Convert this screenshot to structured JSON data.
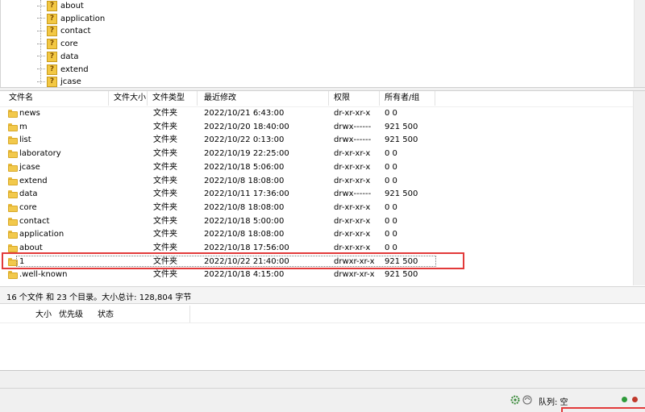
{
  "tree": {
    "items": [
      "about",
      "application",
      "contact",
      "core",
      "data",
      "extend",
      "jcase"
    ]
  },
  "filelist": {
    "headers": {
      "name": "文件名",
      "size": "文件大小",
      "type": "文件类型",
      "modified": "最近修改",
      "perms": "权限",
      "owner": "所有者/组"
    },
    "rows": [
      {
        "name": "news",
        "type": "文件夹",
        "modified": "2022/10/21 6:43:00",
        "perms": "dr-xr-xr-x",
        "owner": "0 0"
      },
      {
        "name": "m",
        "type": "文件夹",
        "modified": "2022/10/20 18:40:00",
        "perms": "drwx------",
        "owner": "921 500"
      },
      {
        "name": "list",
        "type": "文件夹",
        "modified": "2022/10/22 0:13:00",
        "perms": "drwx------",
        "owner": "921 500"
      },
      {
        "name": "laboratory",
        "type": "文件夹",
        "modified": "2022/10/19 22:25:00",
        "perms": "dr-xr-xr-x",
        "owner": "0 0"
      },
      {
        "name": "jcase",
        "type": "文件夹",
        "modified": "2022/10/18 5:06:00",
        "perms": "dr-xr-xr-x",
        "owner": "0 0"
      },
      {
        "name": "extend",
        "type": "文件夹",
        "modified": "2022/10/8 18:08:00",
        "perms": "dr-xr-xr-x",
        "owner": "0 0"
      },
      {
        "name": "data",
        "type": "文件夹",
        "modified": "2022/10/11 17:36:00",
        "perms": "drwx------",
        "owner": "921 500"
      },
      {
        "name": "core",
        "type": "文件夹",
        "modified": "2022/10/8 18:08:00",
        "perms": "dr-xr-xr-x",
        "owner": "0 0"
      },
      {
        "name": "contact",
        "type": "文件夹",
        "modified": "2022/10/18 5:00:00",
        "perms": "dr-xr-xr-x",
        "owner": "0 0"
      },
      {
        "name": "application",
        "type": "文件夹",
        "modified": "2022/10/8 18:08:00",
        "perms": "dr-xr-xr-x",
        "owner": "0 0"
      },
      {
        "name": "about",
        "type": "文件夹",
        "modified": "2022/10/18 17:56:00",
        "perms": "dr-xr-xr-x",
        "owner": "0 0"
      },
      {
        "name": "1",
        "type": "文件夹",
        "modified": "2022/10/22 21:40:00",
        "perms": "drwxr-xr-x",
        "owner": "921 500"
      },
      {
        "name": ".well-known",
        "type": "文件夹",
        "modified": "2022/10/18 4:15:00",
        "perms": "drwxr-xr-x",
        "owner": "921 500"
      }
    ]
  },
  "status": {
    "summary": "16 个文件 和 23 个目录。大小总计: 128,804 字节"
  },
  "queue": {
    "headers": {
      "size": "大小",
      "priority": "优先级",
      "status": "状态"
    }
  },
  "bottombar": {
    "queue_label": "队列: 空"
  },
  "colors": {
    "highlight": "#e23a3a",
    "folder": "#f2c94c"
  }
}
